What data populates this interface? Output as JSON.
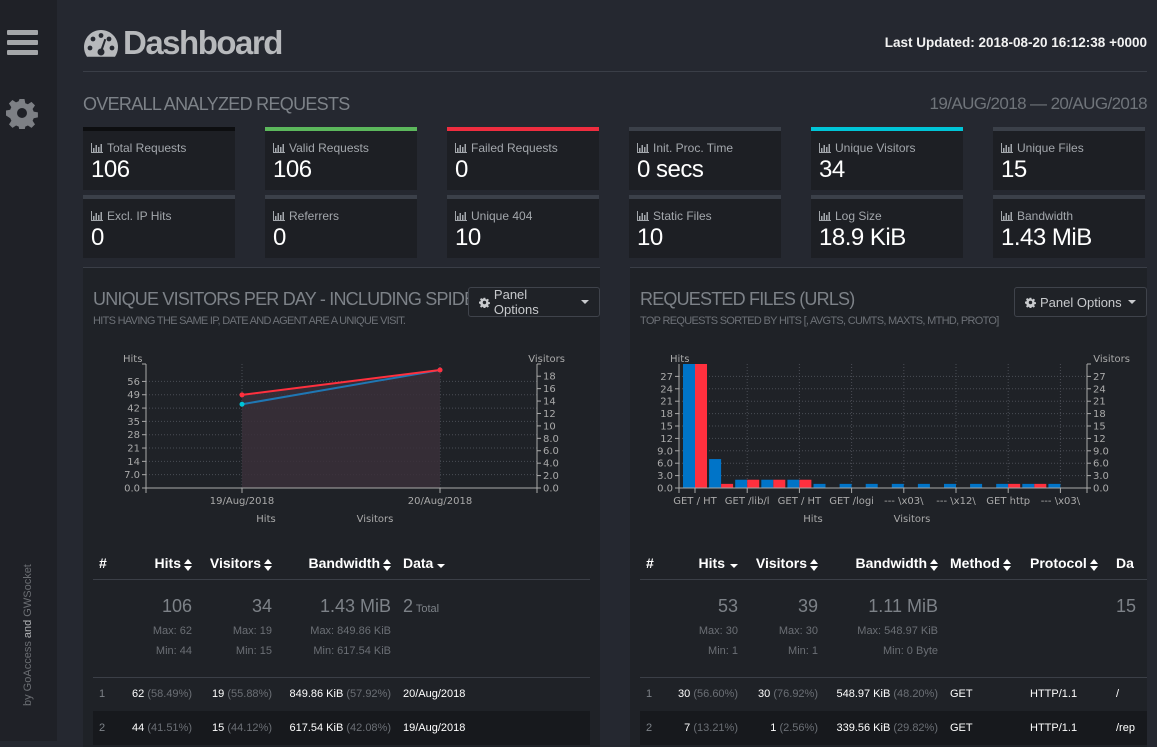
{
  "sidebar": {
    "menu_icon": "hamburger-icon",
    "settings_icon": "gear-icon",
    "credit": {
      "prefix": "by ",
      "a": "GoAccess",
      "and": " and ",
      "b": "GWSocket"
    }
  },
  "header": {
    "title": "Dashboard",
    "title_icon": "dashboard-icon",
    "last_updated": "Last Updated: 2018-08-20 16:12:38 +0000"
  },
  "overall": {
    "title": "OVERALL ANALYZED REQUESTS",
    "date_range": "19/AUG/2018 — 20/AUG/2018",
    "cards": [
      {
        "label": "Total Requests",
        "value": "106",
        "accent": "#0d0e10"
      },
      {
        "label": "Valid Requests",
        "value": "106",
        "accent": "#5cb85c"
      },
      {
        "label": "Failed Requests",
        "value": "0",
        "accent": "#ef2d3f"
      },
      {
        "label": "Init. Proc. Time",
        "value": "0 secs",
        "accent": "#3b4049"
      },
      {
        "label": "Unique Visitors",
        "value": "34",
        "accent": "#00c5d7"
      },
      {
        "label": "Unique Files",
        "value": "15",
        "accent": "#3b4049"
      },
      {
        "label": "Excl. IP Hits",
        "value": "0",
        "accent": "#3b4049"
      },
      {
        "label": "Referrers",
        "value": "0",
        "accent": "#3b4049"
      },
      {
        "label": "Unique 404",
        "value": "10",
        "accent": "#3b4049"
      },
      {
        "label": "Static Files",
        "value": "10",
        "accent": "#3b4049"
      },
      {
        "label": "Log Size",
        "value": "18.9 KiB",
        "accent": "#3b4049"
      },
      {
        "label": "Bandwidth",
        "value": "1.43 MiB",
        "accent": "#3b4049"
      }
    ]
  },
  "visitors_panel": {
    "title": "UNIQUE VISITORS PER DAY - INCLUDING SPIDERS",
    "subtitle": "HITS HAVING THE SAME IP, DATE AND AGENT ARE A UNIQUE VISIT.",
    "options_label": "Panel Options",
    "table": {
      "headers": [
        "#",
        "Hits",
        "Visitors",
        "Bandwidth",
        "Data"
      ],
      "summary": {
        "hits": "106",
        "hits_max": "Max: 62",
        "hits_min": "Min: 44",
        "visitors": "34",
        "visitors_max": "Max: 19",
        "visitors_min": "Min: 15",
        "bw": "1.43 MiB",
        "bw_max": "Max: 849.86 KiB",
        "bw_min": "Min: 617.54 KiB",
        "total": "2",
        "total_label": "Total"
      },
      "rows": [
        {
          "idx": "1",
          "hits": "62",
          "hits_pct": "(58.49%)",
          "visitors": "19",
          "visitors_pct": "(55.88%)",
          "bw": "849.86 KiB",
          "bw_pct": "(57.92%)",
          "data": "20/Aug/2018"
        },
        {
          "idx": "2",
          "hits": "44",
          "hits_pct": "(41.51%)",
          "visitors": "15",
          "visitors_pct": "(44.12%)",
          "bw": "617.54 KiB",
          "bw_pct": "(42.08%)",
          "data": "19/Aug/2018"
        }
      ]
    }
  },
  "files_panel": {
    "title": "REQUESTED FILES (URLS)",
    "subtitle": "TOP REQUESTS SORTED BY HITS [, AVGTS, CUMTS, MAXTS, MTHD, PROTO]",
    "options_label": "Panel Options",
    "table": {
      "headers": [
        "#",
        "Hits",
        "Visitors",
        "Bandwidth",
        "Method",
        "Protocol",
        "Da"
      ],
      "summary": {
        "hits": "53",
        "hits_max": "Max: 30",
        "hits_min": "Min: 1",
        "visitors": "39",
        "visitors_max": "Max: 30",
        "visitors_min": "Min: 1",
        "bw": "1.11 MiB",
        "bw_max": "Max: 548.97 KiB",
        "bw_min": "Min: 0 Byte",
        "total": "15"
      },
      "rows": [
        {
          "idx": "1",
          "hits": "30",
          "hits_pct": "(56.60%)",
          "visitors": "30",
          "visitors_pct": "(76.92%)",
          "bw": "548.97 KiB",
          "bw_pct": "(48.20%)",
          "method": "GET",
          "protocol": "HTTP/1.1",
          "data": "/"
        },
        {
          "idx": "2",
          "hits": "7",
          "hits_pct": "(13.21%)",
          "visitors": "1",
          "visitors_pct": "(2.56%)",
          "bw": "339.56 KiB",
          "bw_pct": "(29.82%)",
          "method": "GET",
          "protocol": "HTTP/1.1",
          "data": "/rep"
        }
      ]
    }
  },
  "colors": {
    "hits": "#0074c8",
    "visitors": "#ff303e",
    "hits_line": "#1f77b4",
    "area": "#3a2f3a",
    "point_hits": "#00c5d7"
  },
  "chart_data": [
    {
      "type": "line",
      "title": "Unique visitors per day",
      "categories": [
        "19/Aug/2018",
        "20/Aug/2018"
      ],
      "series": [
        {
          "name": "Hits",
          "axis": "left",
          "values": [
            44,
            62
          ]
        },
        {
          "name": "Visitors",
          "axis": "right",
          "values": [
            15,
            19
          ]
        }
      ],
      "ylabel_left": "Hits",
      "ylabel_right": "Visitors",
      "y_left_ticks": [
        "0.0",
        "7.0",
        "14",
        "21",
        "28",
        "35",
        "42",
        "49",
        "56"
      ],
      "y_right_ticks": [
        "0.0",
        "2.0",
        "4.0",
        "6.0",
        "8.0",
        "10",
        "12",
        "14",
        "16",
        "18"
      ],
      "ylim_left": [
        0,
        62
      ],
      "ylim_right": [
        0,
        19
      ],
      "legend": [
        "Hits",
        "Visitors"
      ],
      "legend_position": "bottom",
      "grid": true
    },
    {
      "type": "bar",
      "title": "Requested files",
      "categories": [
        "GET / HT",
        "",
        "GET /lib/l",
        "",
        "GET / HT",
        "",
        "GET /logi",
        "",
        "--- \\x03\\",
        "",
        "--- \\x12\\",
        "",
        "GET http",
        "",
        "--- \\x03\\"
      ],
      "tick_labels": [
        "GET / HT",
        "GET /lib/l",
        "GET / HT",
        "GET /logi",
        "--- \\x03\\",
        "--- \\x12\\",
        "GET http",
        "--- \\x03\\"
      ],
      "series": [
        {
          "name": "Hits",
          "values": [
            30,
            7,
            2,
            2,
            2,
            1,
            1,
            1,
            1,
            1,
            1,
            1,
            1,
            1,
            1
          ]
        },
        {
          "name": "Visitors",
          "values": [
            30,
            1,
            2,
            2,
            2,
            0,
            0,
            0,
            0,
            0,
            0,
            0,
            1,
            1,
            0
          ]
        }
      ],
      "ylabel_left": "Hits",
      "ylabel_right": "Visitors",
      "y_ticks": [
        "0.0",
        "3.0",
        "6.0",
        "9.0",
        "12",
        "15",
        "18",
        "21",
        "24",
        "27"
      ],
      "ylim": [
        0,
        30
      ],
      "legend": [
        "Hits",
        "Visitors"
      ],
      "legend_position": "bottom",
      "grid": true
    }
  ]
}
